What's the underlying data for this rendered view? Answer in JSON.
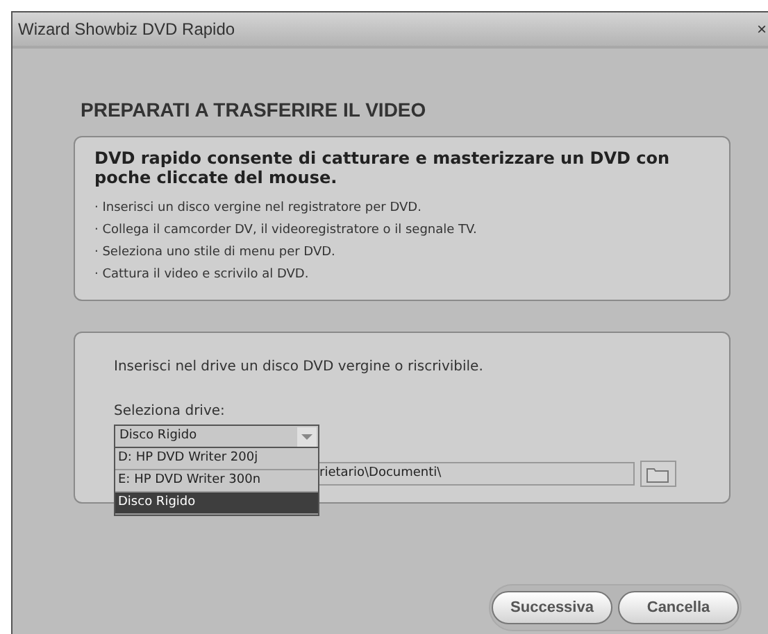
{
  "window": {
    "title": "Wizard Showbiz DVD Rapido",
    "close": "×"
  },
  "heading": "PREPARATI A TRASFERIRE IL VIDEO",
  "intro": {
    "lead": "DVD rapido consente di catturare e masterizzare un DVD con poche cliccate del mouse.",
    "steps": [
      "· Inserisci un disco vergine nel registratore per DVD.",
      "· Collega il camcorder DV, il videoregistratore o il segnale TV.",
      "· Seleziona uno stile di menu per DVD.",
      "· Cattura il video e scrivilo al DVD."
    ]
  },
  "drive_panel": {
    "instruction": "Inserisci nel drive un disco DVD vergine o riscrivibile.",
    "drive_label": "Seleziona drive:",
    "drive_select": {
      "value": "Disco Rigido",
      "expanded": true,
      "options": [
        {
          "label": "D: HP DVD Writer 200j",
          "selected": false
        },
        {
          "label": "E: HP DVD Writer 300n",
          "selected": false
        },
        {
          "label": "Disco Rigido",
          "selected": true
        }
      ]
    },
    "path_field": {
      "value": "rietario\\Documenti\\"
    }
  },
  "buttons": [
    "Successiva",
    "Cancella"
  ]
}
